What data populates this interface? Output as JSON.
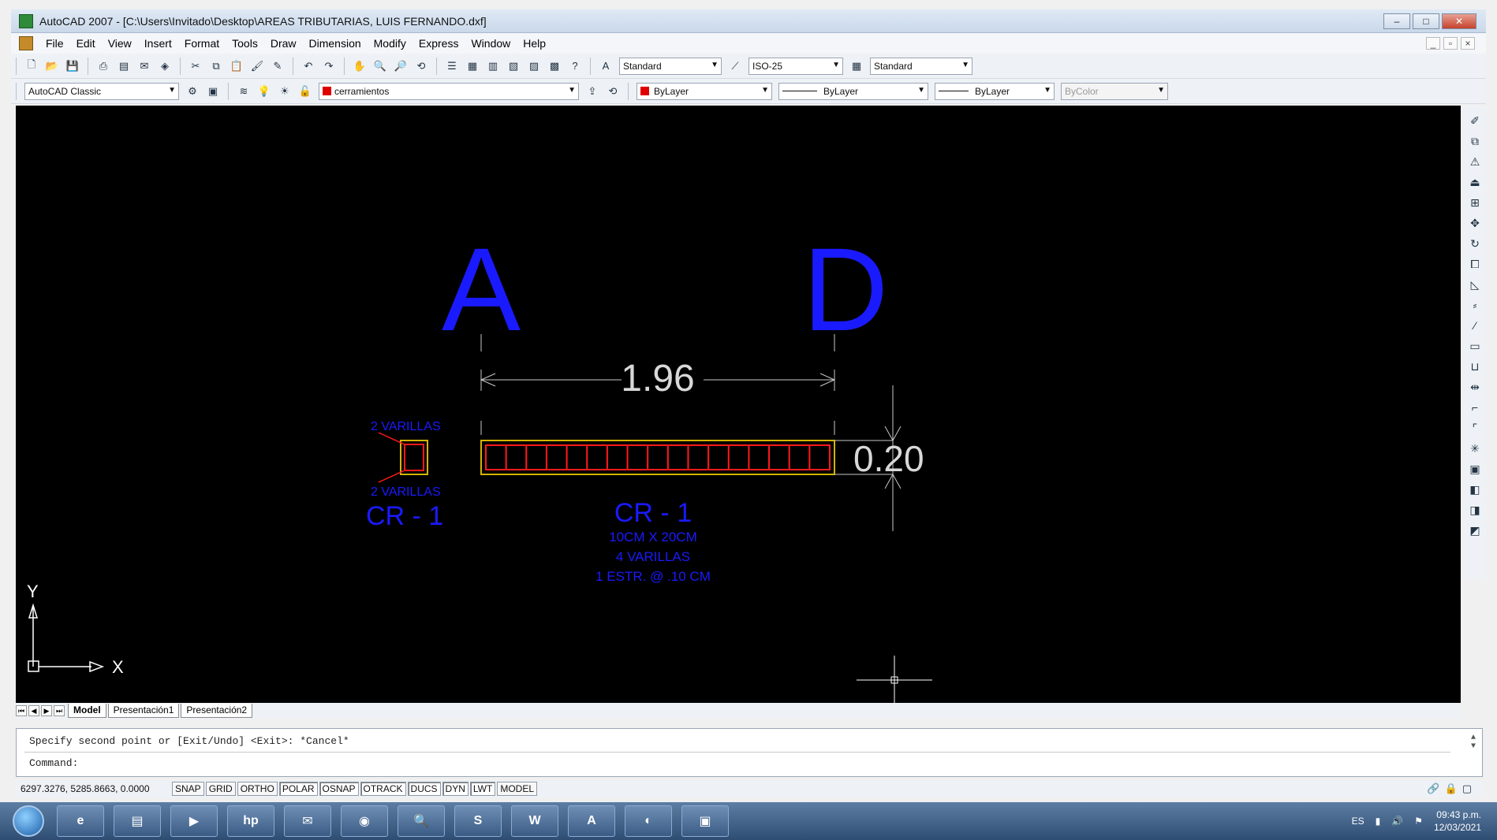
{
  "window": {
    "title": "AutoCAD 2007 - [C:\\Users\\Invitado\\Desktop\\AREAS TRIBUTARIAS, LUIS FERNANDO.dxf]",
    "buttons": [
      "–",
      "□",
      "✕"
    ]
  },
  "menu": [
    "File",
    "Edit",
    "View",
    "Insert",
    "Format",
    "Tools",
    "Draw",
    "Dimension",
    "Modify",
    "Express",
    "Window",
    "Help"
  ],
  "toolbar1": {
    "text_style": "Standard",
    "dim_style": "ISO-25",
    "table_style": "Standard"
  },
  "toolbar2": {
    "workspace": "AutoCAD Classic",
    "layer": "cerramientos",
    "color": "ByLayer",
    "linetype": "ByLayer",
    "lineweight": "ByLayer",
    "plotstyle": "ByColor"
  },
  "drawing": {
    "label_a": "A",
    "label_d": "D",
    "dim_length": "1.96",
    "dim_height": "0.20",
    "section_top": "2 VARILLAS",
    "section_bottom": "2 VARILLAS",
    "section_title": "CR - 1",
    "beam_title": "CR - 1",
    "beam_line1": "10CM X 20CM",
    "beam_line2": "4 VARILLAS",
    "beam_line3": "1 ESTR. @ .10 CM",
    "ucs_y": "Y",
    "ucs_x": "X",
    "segments": 17
  },
  "tabs": [
    "Model",
    "Presentación1",
    "Presentación2"
  ],
  "command": {
    "line1": "Specify second point or [Exit/Undo] <Exit>: *Cancel*",
    "line2": "Command:"
  },
  "status": {
    "coords": "6297.3276, 5285.8663, 0.0000",
    "buttons": [
      "SNAP",
      "GRID",
      "ORTHO",
      "POLAR",
      "OSNAP",
      "OTRACK",
      "DUCS",
      "DYN",
      "LWT",
      "MODEL"
    ],
    "on_buttons": [
      "POLAR",
      "OSNAP",
      "OTRACK",
      "DUCS",
      "DYN",
      "LWT"
    ]
  },
  "taskbar": {
    "items": [
      "ie",
      "explorer",
      "media",
      "hp",
      "mail",
      "chrome",
      "search",
      "skype",
      "word",
      "autocad",
      "app",
      "app2"
    ],
    "lang": "ES",
    "time": "09:43 p.m.",
    "date": "12/03/2021"
  },
  "colors": {
    "canvas": "#000000",
    "blue_text": "#1a1aff",
    "beam_red": "#ff1a1a",
    "beam_yellow": "#d4b400",
    "dim_gray": "#c8c8c8"
  }
}
